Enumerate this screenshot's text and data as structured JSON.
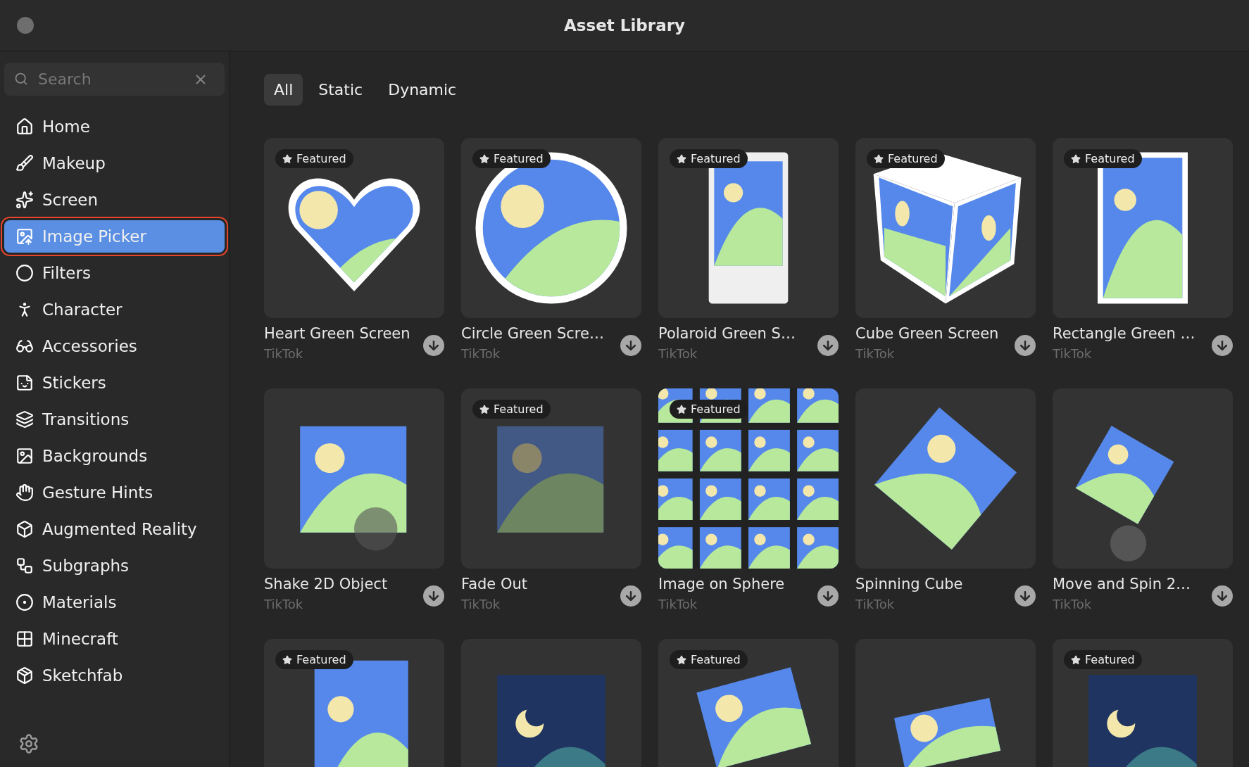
{
  "window": {
    "title": "Asset Library"
  },
  "search": {
    "placeholder": "Search"
  },
  "sidebar": {
    "items": [
      {
        "label": "Home",
        "selected": false
      },
      {
        "label": "Makeup",
        "selected": false
      },
      {
        "label": "Screen",
        "selected": false
      },
      {
        "label": "Image Picker",
        "selected": true
      },
      {
        "label": "Filters",
        "selected": false
      },
      {
        "label": "Character",
        "selected": false
      },
      {
        "label": "Accessories",
        "selected": false
      },
      {
        "label": "Stickers",
        "selected": false
      },
      {
        "label": "Transitions",
        "selected": false
      },
      {
        "label": "Backgrounds",
        "selected": false
      },
      {
        "label": "Gesture Hints",
        "selected": false
      },
      {
        "label": "Augmented Reality",
        "selected": false
      },
      {
        "label": "Subgraphs",
        "selected": false
      },
      {
        "label": "Materials",
        "selected": false
      },
      {
        "label": "Minecraft",
        "selected": false
      },
      {
        "label": "Sketchfab",
        "selected": false
      }
    ]
  },
  "tabs": [
    {
      "label": "All",
      "selected": true
    },
    {
      "label": "Static",
      "selected": false
    },
    {
      "label": "Dynamic",
      "selected": false
    }
  ],
  "cards": [
    {
      "title": "Heart Green Screen",
      "author": "TikTok",
      "featured": true,
      "badge": "Featured"
    },
    {
      "title": "Circle Green Scre…",
      "author": "TikTok",
      "featured": true,
      "badge": "Featured"
    },
    {
      "title": "Polaroid Green S…",
      "author": "TikTok",
      "featured": true,
      "badge": "Featured"
    },
    {
      "title": "Cube Green Screen",
      "author": "TikTok",
      "featured": true,
      "badge": "Featured"
    },
    {
      "title": "Rectangle Green …",
      "author": "TikTok",
      "featured": true,
      "badge": "Featured"
    },
    {
      "title": "Shake 2D Object",
      "author": "TikTok",
      "featured": false
    },
    {
      "title": "Fade Out",
      "author": "TikTok",
      "featured": true,
      "badge": "Featured"
    },
    {
      "title": "Image on Sphere",
      "author": "TikTok",
      "featured": true,
      "badge": "Featured"
    },
    {
      "title": "Spinning Cube",
      "author": "TikTok",
      "featured": false
    },
    {
      "title": "Move and Spin 2…",
      "author": "TikTok",
      "featured": false
    },
    {
      "featured": true,
      "badge": "Featured"
    },
    {
      "featured": false
    },
    {
      "featured": true,
      "badge": "Featured"
    },
    {
      "featured": false
    },
    {
      "featured": true,
      "badge": "Featured"
    }
  ]
}
